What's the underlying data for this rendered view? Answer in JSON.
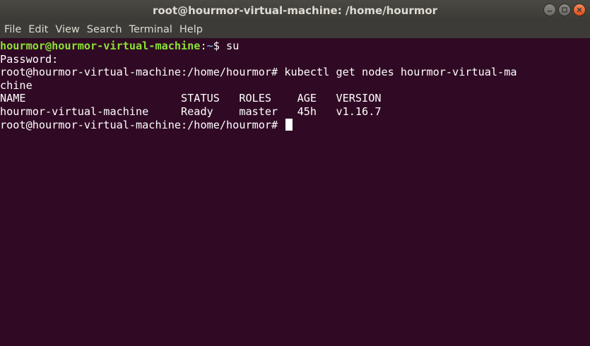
{
  "window": {
    "title": "root@hourmor-virtual-machine: /home/hourmor",
    "buttons": [
      "minimize",
      "maximize",
      "close"
    ],
    "icons": {
      "minimize": "minimize-icon",
      "maximize": "maximize-icon",
      "close": "close-icon"
    }
  },
  "menubar": {
    "items": [
      "File",
      "Edit",
      "View",
      "Search",
      "Terminal",
      "Help"
    ]
  },
  "colors": {
    "background": "#300a24",
    "prompt_user": "#8ae234",
    "prompt_path": "#729fcf",
    "text": "#ffffff",
    "titlebar": "#3c3b37"
  },
  "terminal": {
    "line1": {
      "user": "hourmor@hourmor-virtual-machine",
      "sep": ":",
      "path": "~",
      "cmd": "$ su"
    },
    "line2": "Password:",
    "line3": "root@hourmor-virtual-machine:/home/hourmor# kubectl get nodes hourmor-virtual-ma",
    "line4": "chine",
    "table_header": "NAME                        STATUS   ROLES    AGE   VERSION",
    "table_row": "hourmor-virtual-machine     Ready    master   45h   v1.16.7",
    "line7": "root@hourmor-virtual-machine:/home/hourmor# "
  }
}
